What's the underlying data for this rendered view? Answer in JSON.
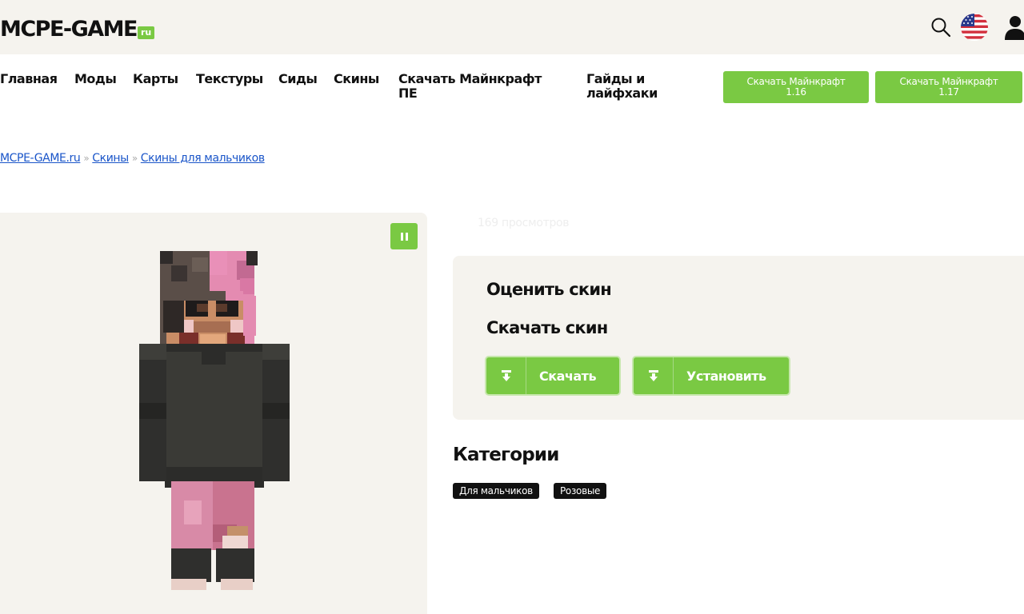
{
  "header": {
    "logo_main": "MCPE-GAME",
    "logo_suffix": "ru"
  },
  "nav": {
    "items": [
      "Главная",
      "Моды",
      "Карты",
      "Текстуры",
      "Сиды",
      "Скины",
      "Скачать Майнкрафт ПЕ",
      "Гайды и лайфхаки"
    ],
    "buttons": [
      {
        "line1": "Скачать Майнкрафт",
        "line2": "1.16"
      },
      {
        "line1": "Скачать Майнкрафт",
        "line2": "1.17"
      }
    ]
  },
  "breadcrumb": {
    "items": [
      "MCPE-GAME.ru",
      "Скины",
      "Скины для мальчиков"
    ],
    "separator": "»"
  },
  "preview": {
    "views": "169 просмотров"
  },
  "panel": {
    "rate_title": "Оценить скин",
    "download_title": "Скачать скин",
    "download_label": "Скачать",
    "install_label": "Установить"
  },
  "categories": {
    "title": "Категории",
    "tags": [
      "Для мальчиков",
      "Розовые"
    ]
  },
  "colors": {
    "accent": "#7ac943",
    "header_bg": "#f5f3ee",
    "link": "#1a55c9"
  }
}
